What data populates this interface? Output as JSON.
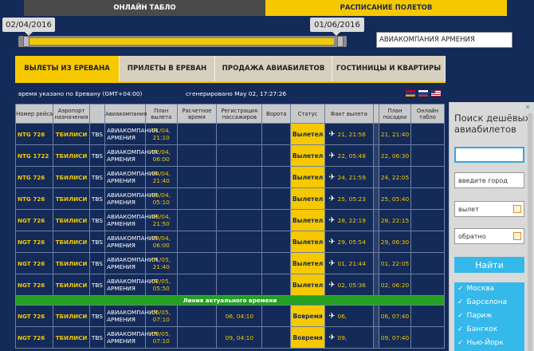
{
  "top_tabs": {
    "online": "ОНЛАЙН ТАБЛО",
    "schedule": "РАСПИСАНИЕ ПОЛЕТОВ"
  },
  "slider": {
    "from": "02/04/2016",
    "to": "01/06/2016"
  },
  "airline_filter": "АВИАКОМПАНИЯ АРМЕНИЯ",
  "section_tabs": [
    "ВЫЛЕТЫ ИЗ ЕРЕВАНА",
    "ПРИЛЕТЫ В ЕРЕВАН",
    "ПРОДАЖА АВИАБИЛЕТОВ",
    "ГОСТИНИЦЫ И КВАРТИРЫ"
  ],
  "info": {
    "timezone": "время указано по Еревану (GMT+04:00)",
    "generated": "сгенерировано May 02, 17:27:26"
  },
  "columns": [
    "Номер рейса",
    "Аэропорт назначения",
    "",
    "Авиакомпания",
    "План вылета",
    "Расчетное время",
    "Регистрация пассажиров",
    "Ворота",
    "Статус",
    "Факт вылета",
    "",
    "План посадки",
    "Онлайн табло"
  ],
  "rows": [
    {
      "num": "NTG 726",
      "dest": "ТБИЛИСИ",
      "code": "TBS",
      "airline": "АВИАКОМПАНИЯ АРМЕНИЯ",
      "plan": "21/04, 21:10",
      "est": "",
      "reg": "",
      "gate": "",
      "status": "Вылетел",
      "fact": "21, 21:56",
      "arr": "21, 21:40"
    },
    {
      "num": "NTG 1722",
      "dest": "ТБИЛИСИ",
      "code": "TBS",
      "airline": "АВИАКОМПАНИЯ АРМЕНИЯ",
      "plan": "22/04, 06:00",
      "est": "",
      "reg": "",
      "gate": "",
      "status": "Вылетел",
      "fact": "22, 05:48",
      "arr": "22, 06:30"
    },
    {
      "num": "NTG 726",
      "dest": "ТБИЛИСИ",
      "code": "TBS",
      "airline": "АВИАКОМПАНИЯ АРМЕНИЯ",
      "plan": "24/04, 21:40",
      "est": "",
      "reg": "",
      "gate": "",
      "status": "Вылетел",
      "fact": "24, 21:59",
      "arr": "24, 22:05"
    },
    {
      "num": "NTG 726",
      "dest": "ТБИЛИСИ",
      "code": "TBS",
      "airline": "АВИАКОМПАНИЯ АРМЕНИЯ",
      "plan": "25/04, 05:10",
      "est": "",
      "reg": "",
      "gate": "",
      "status": "Вылетел",
      "fact": "25, 05:23",
      "arr": "25, 05:40"
    },
    {
      "num": "NGT 726",
      "dest": "ТБИЛИСИ",
      "code": "TBS",
      "airline": "АВИАКОМПАНИЯ АРМЕНИЯ",
      "plan": "28/04, 21:50",
      "est": "",
      "reg": "",
      "gate": "",
      "status": "Вылетел",
      "fact": "28, 22:19",
      "arr": "28, 22:15"
    },
    {
      "num": "NGT 726",
      "dest": "ТБИЛИСИ",
      "code": "TBS",
      "airline": "АВИАКОМПАНИЯ АРМЕНИЯ",
      "plan": "29/04, 06:00",
      "est": "",
      "reg": "",
      "gate": "",
      "status": "Вылетел",
      "fact": "29, 05:54",
      "arr": "29, 06:30"
    },
    {
      "num": "NGT 726",
      "dest": "ТБИЛИСИ",
      "code": "TBS",
      "airline": "АВИАКОМПАНИЯ АРМЕНИЯ",
      "plan": "01/05, 21:40",
      "est": "",
      "reg": "",
      "gate": "",
      "status": "Вылетел",
      "fact": "01, 21:44",
      "arr": "01, 22:05"
    },
    {
      "num": "NGT 726",
      "dest": "ТБИЛИСИ",
      "code": "TBS",
      "airline": "АВИАКОМПАНИЯ АРМЕНИЯ",
      "plan": "02/05, 05:50",
      "est": "",
      "reg": "",
      "gate": "",
      "status": "Вылетел",
      "fact": "02, 05:36",
      "arr": "02, 06:20"
    }
  ],
  "current_time_line": "Линия актуального времени",
  "future_rows": [
    {
      "num": "NGT 726",
      "dest": "ТБИЛИСИ",
      "code": "TBS",
      "airline": "АВИАКОМПАНИЯ АРМЕНИЯ",
      "plan": "06/05, 07:10",
      "est": "",
      "reg": "06, 04:10",
      "gate": "",
      "status": "Вовремя",
      "fact": "06,",
      "arr": "06, 07:40"
    },
    {
      "num": "NGT 726",
      "dest": "ТБИЛИСИ",
      "code": "TBS",
      "airline": "АВИАКОМПАНИЯ АРМЕНИЯ",
      "plan": "09/05, 07:10",
      "est": "",
      "reg": "09, 04:10",
      "gate": "",
      "status": "Вовремя",
      "fact": "09,",
      "arr": "09, 07:40"
    }
  ],
  "ad": {
    "close": "✕",
    "title": "Поиск дешёвых авиабилетов",
    "from_placeholder": "",
    "to_placeholder": "введите город",
    "depart": "вылет",
    "return": "обратно",
    "button": "Найти",
    "cities": [
      "Москва",
      "Барселона",
      "Париж",
      "Бангкок",
      "Нью-Йорк"
    ]
  },
  "colors": {
    "background": "#142a58",
    "accent": "#f5c800",
    "line": "#23a021",
    "ad_accent": "#35b8ea"
  }
}
